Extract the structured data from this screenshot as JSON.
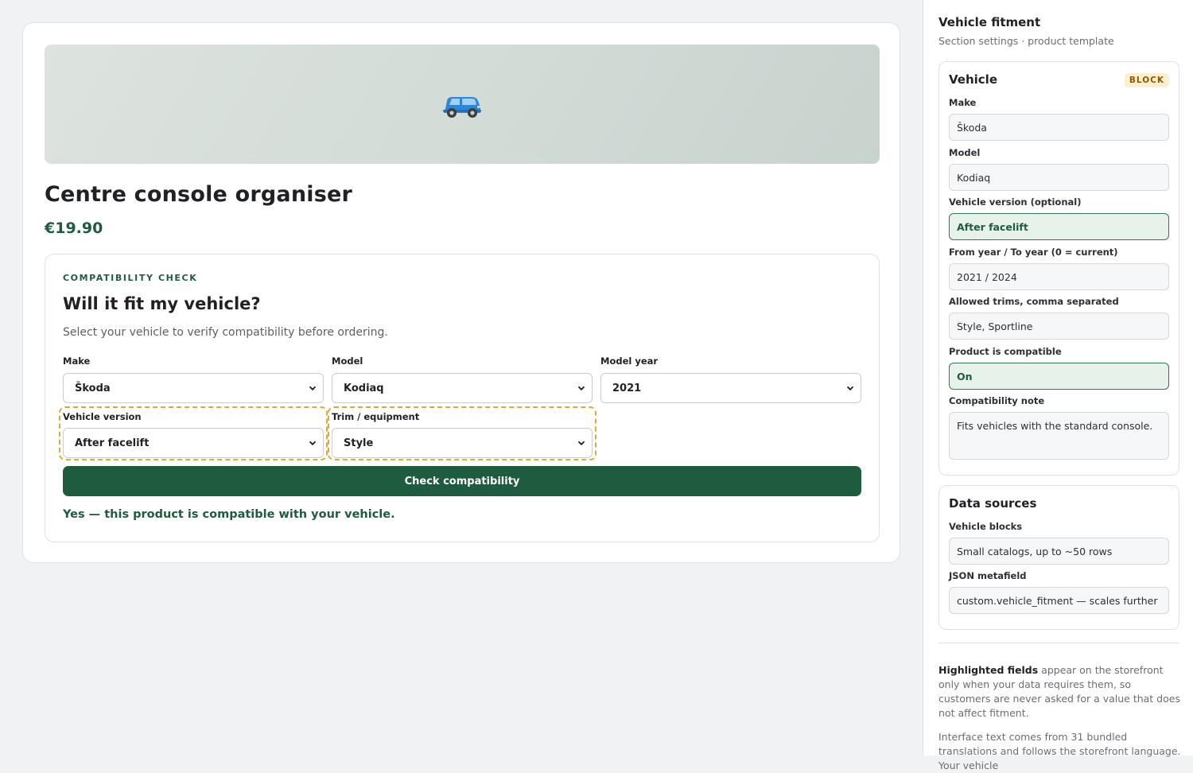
{
  "product": {
    "image_icon": "car-icon",
    "title": "Centre console organiser",
    "price": "€19.90"
  },
  "compatibility": {
    "eyebrow": "COMPATIBILITY CHECK",
    "title": "Will it fit my vehicle?",
    "subtitle": "Select your vehicle to verify compatibility before ordering.",
    "fields": {
      "make": {
        "label": "Make",
        "value": "Škoda"
      },
      "model": {
        "label": "Model",
        "value": "Kodiaq"
      },
      "year": {
        "label": "Model year",
        "value": "2021"
      },
      "version": {
        "label": "Vehicle version",
        "value": "After facelift",
        "highlighted": true
      },
      "trim": {
        "label": "Trim / equipment",
        "value": "Style",
        "highlighted": true
      }
    },
    "button_label": "Check compatibility",
    "result": "Yes — this product is compatible with your vehicle."
  },
  "panel": {
    "title": "Vehicle fitment",
    "subtitle": "Section settings · product template",
    "vehicle_block": {
      "title": "Vehicle",
      "badge": "BLOCK",
      "fields": {
        "make": {
          "label": "Make",
          "value": "Škoda"
        },
        "model": {
          "label": "Model",
          "value": "Kodiaq"
        },
        "version": {
          "label": "Vehicle version (optional)",
          "value": "After facelift"
        },
        "years": {
          "label": "From year / To year (0 = current)",
          "value": "2021 / 2024"
        },
        "trims": {
          "label": "Allowed trims, comma separated",
          "value": "Style, Sportline"
        },
        "compatible": {
          "label": "Product is compatible",
          "value": "On"
        },
        "note": {
          "label": "Compatibility note",
          "value": "Fits vehicles with the standard console."
        }
      }
    },
    "data_sources": {
      "title": "Data sources",
      "fields": {
        "blocks": {
          "label": "Vehicle blocks",
          "value": "Small catalogs, up to ~50 rows"
        },
        "metafield": {
          "label": "JSON metafield",
          "value": "custom.vehicle_fitment — scales further"
        }
      }
    },
    "help1_strong": "Highlighted fields",
    "help1_rest": " appear on the storefront only when your data requires them, so customers are never asked for a value that does not affect fitment.",
    "help2": "Interface text comes from 31 bundled translations and follows the storefront language. Your vehicle"
  },
  "colors": {
    "accent": "#1f5c3f",
    "highlight": "#e0a73a",
    "badge_bg": "#fcefcf"
  }
}
